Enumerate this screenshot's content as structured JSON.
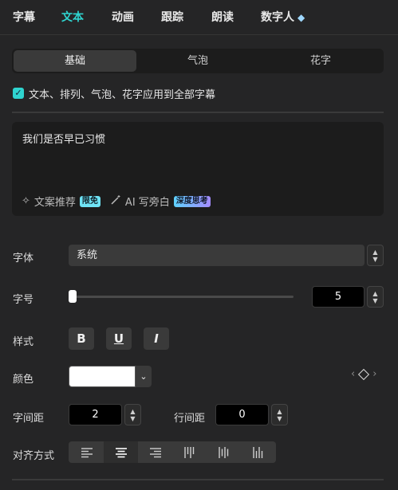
{
  "tabs": [
    {
      "label": "字幕"
    },
    {
      "label": "文本"
    },
    {
      "label": "动画"
    },
    {
      "label": "跟踪"
    },
    {
      "label": "朗读"
    },
    {
      "label": "数字人"
    }
  ],
  "active_tab": "文本",
  "accent_color": "#2fd4cf",
  "subtabs": [
    {
      "label": "基础"
    },
    {
      "label": "气泡"
    },
    {
      "label": "花字"
    }
  ],
  "apply_all": {
    "checked": true,
    "label": "文本、排列、气泡、花字应用到全部字幕"
  },
  "text_box": {
    "content": "我们是否早已习惯",
    "copy_suggest_label": "文案推荐",
    "copy_suggest_badge": "限免",
    "ai_label": "AI 写旁白",
    "ai_badge": "深度思考"
  },
  "font": {
    "label": "字体",
    "value": "系统"
  },
  "size": {
    "label": "字号",
    "value": "5",
    "slider_fraction": 0.0
  },
  "style": {
    "label": "样式",
    "bold": "B",
    "underline": "U",
    "italic": "I"
  },
  "color": {
    "label": "颜色",
    "value": "#ffffff"
  },
  "letter_spacing": {
    "label": "字间距",
    "value": "2"
  },
  "line_spacing": {
    "label": "行间距",
    "value": "0"
  },
  "alignment": {
    "label": "对齐方式",
    "selected_index": 1
  },
  "icons": {
    "premium": "diamond-icon",
    "checkbox": "check-icon",
    "copy_suggest": "sparkle-icon",
    "ai": "magic-wand-icon",
    "spinner": "up-down-arrows-icon",
    "keyframe": "keyframe-diamond-icon"
  }
}
